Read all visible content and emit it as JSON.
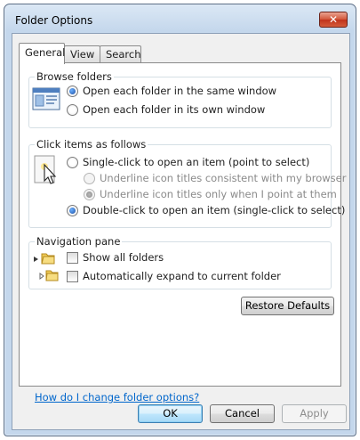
{
  "window": {
    "title": "Folder Options",
    "close_glyph": "✕"
  },
  "tabs": [
    {
      "label": "General",
      "active": true
    },
    {
      "label": "View",
      "active": false
    },
    {
      "label": "Search",
      "active": false
    }
  ],
  "browse_folders": {
    "title": "Browse folders",
    "options": [
      {
        "label": "Open each folder in the same window",
        "selected": true
      },
      {
        "label": "Open each folder in its own window",
        "selected": false
      }
    ],
    "icon": "window-icon"
  },
  "click_items": {
    "title": "Click items as follows",
    "icon": "cursor-click-icon",
    "single_click": {
      "label": "Single-click to open an item (point to select)",
      "selected": false
    },
    "underline_browser": {
      "label": "Underline icon titles consistent with my browser",
      "selected": false,
      "enabled": false
    },
    "underline_point": {
      "label": "Underline icon titles only when I point at them",
      "selected": true,
      "enabled": false
    },
    "double_click": {
      "label": "Double-click to open an item (single-click to select)",
      "selected": true
    }
  },
  "navigation_pane": {
    "title": "Navigation pane",
    "show_all_folders": {
      "label": "Show all folders",
      "checked": false
    },
    "auto_expand": {
      "label": "Automatically expand to current folder",
      "checked": false
    },
    "icons": [
      "folder-icon",
      "folder-icon"
    ]
  },
  "restore_defaults_label": "Restore Defaults",
  "help_link": "How do I change folder options?",
  "buttons": {
    "ok": "OK",
    "cancel": "Cancel",
    "apply": "Apply"
  },
  "colors": {
    "accent": "#1d4fa3",
    "link": "#0066cc",
    "close": "#c1331b",
    "frame": "#c4d7ec"
  }
}
